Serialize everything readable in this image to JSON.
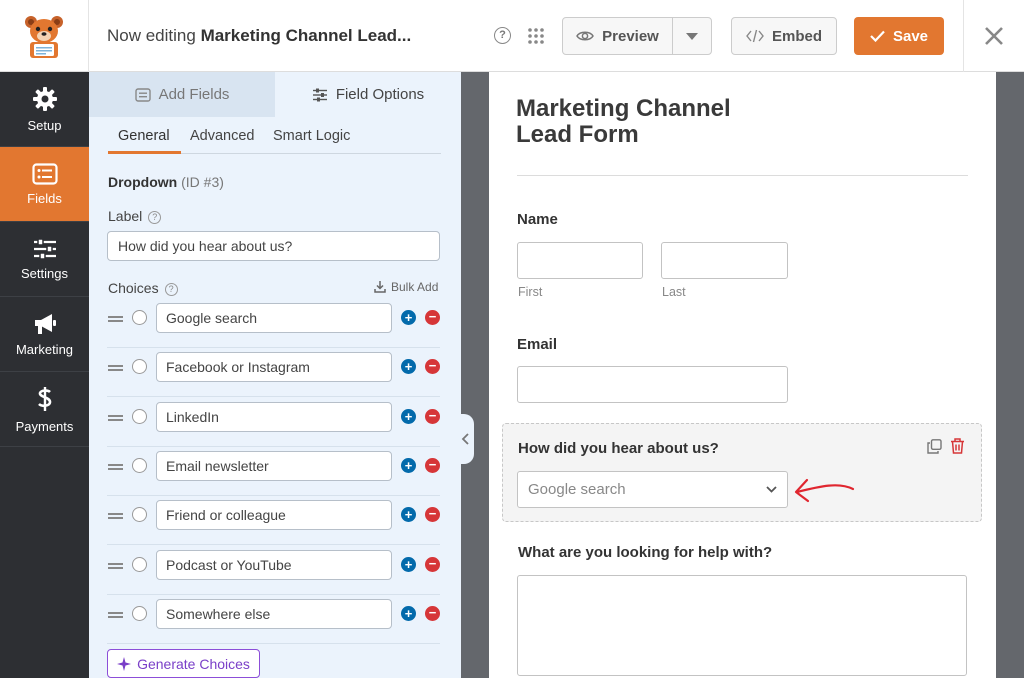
{
  "header": {
    "editing_prefix": "Now editing",
    "form_name": "Marketing Channel Lead...",
    "preview_label": "Preview",
    "embed_label": "Embed",
    "save_label": "Save"
  },
  "leftnav": {
    "items": [
      {
        "label": "Setup",
        "icon": "gear-icon"
      },
      {
        "label": "Fields",
        "icon": "list-icon",
        "active": true
      },
      {
        "label": "Settings",
        "icon": "sliders-icon"
      },
      {
        "label": "Marketing",
        "icon": "megaphone-icon"
      },
      {
        "label": "Payments",
        "icon": "dollar-icon"
      }
    ]
  },
  "panel": {
    "tabs": [
      "Add Fields",
      "Field Options"
    ],
    "subtabs": [
      "General",
      "Advanced",
      "Smart Logic"
    ],
    "field_type": "Dropdown",
    "field_id": "(ID #3)",
    "label_title": "Label",
    "label_value": "How did you hear about us?",
    "choices_title": "Choices",
    "bulk_add": "Bulk Add",
    "choices": [
      "Google search",
      "Facebook or Instagram",
      "LinkedIn",
      "Email newsletter",
      "Friend or colleague",
      "Podcast or YouTube",
      "Somewhere else"
    ],
    "generate_label": "Generate Choices"
  },
  "form": {
    "title": "Marketing Channel Lead Form",
    "name_label": "Name",
    "first_label": "First",
    "last_label": "Last",
    "email_label": "Email",
    "dropdown_label": "How did you hear about us?",
    "dropdown_value": "Google search",
    "help_label": "What are you looking for help with?"
  },
  "colors": {
    "accent": "#e27730",
    "nav_bg": "#2d2f33",
    "panel_bg": "#ebf3fc",
    "add_button": "#036aab",
    "remove_button": "#d63638",
    "annotation_arrow": "#e0262f"
  }
}
